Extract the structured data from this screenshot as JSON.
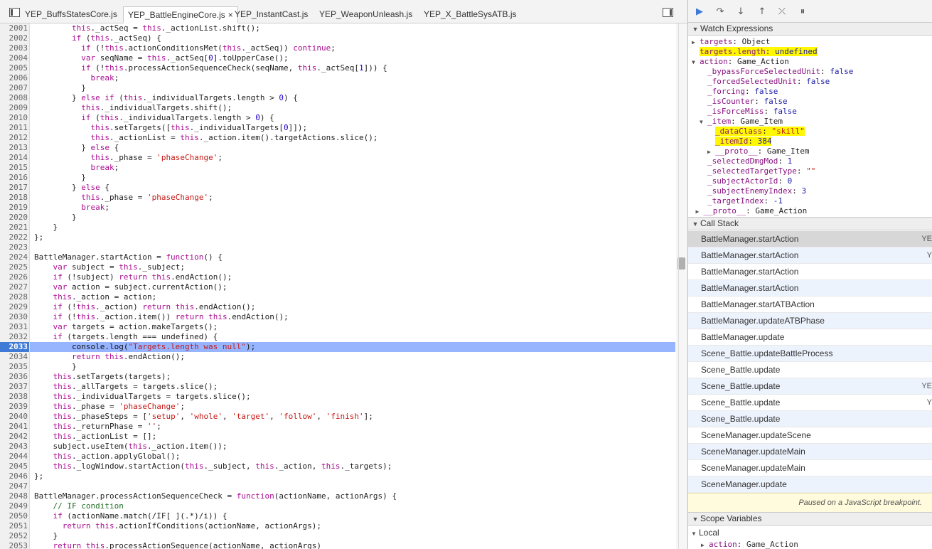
{
  "tabs": {
    "nav_left_icon": "panel-toggle-icon",
    "nav_right_icon": "panel-toggle-icon",
    "items": [
      {
        "label": "YEP_BuffsStatesCore.js"
      },
      {
        "label": "YEP_BattleEngineCore.js",
        "active": true,
        "close": "×"
      },
      {
        "label": "YEP_InstantCast.js"
      },
      {
        "label": "YEP_WeaponUnleash.js"
      },
      {
        "label": "YEP_X_BattleSysATB.js"
      }
    ]
  },
  "debug_toolbar": {
    "resume_icon": "▶",
    "step_over_icon": "↷",
    "step_into_icon": "↓",
    "step_out_icon": "↑",
    "deactivate_icon": "⤫",
    "pause_exceptions_icon": "⏸"
  },
  "code": [
    {
      "n": "2001",
      "t": "        this._actSeq = this._actionList.shift();"
    },
    {
      "n": "2002",
      "t": "        if (this._actSeq) {"
    },
    {
      "n": "2003",
      "t": "          if (!this.actionConditionsMet(this._actSeq)) continue;"
    },
    {
      "n": "2004",
      "t": "          var seqName = this._actSeq[0].toUpperCase();"
    },
    {
      "n": "2005",
      "t": "          if (!this.processActionSequenceCheck(seqName, this._actSeq[1])) {"
    },
    {
      "n": "2006",
      "t": "            break;"
    },
    {
      "n": "2007",
      "t": "          }"
    },
    {
      "n": "2008",
      "t": "        } else if (this._individualTargets.length > 0) {"
    },
    {
      "n": "2009",
      "t": "          this._individualTargets.shift();"
    },
    {
      "n": "2010",
      "t": "          if (this._individualTargets.length > 0) {"
    },
    {
      "n": "2011",
      "t": "            this.setTargets([this._individualTargets[0]]);"
    },
    {
      "n": "2012",
      "t": "            this._actionList = this._action.item().targetActions.slice();"
    },
    {
      "n": "2013",
      "t": "          } else {"
    },
    {
      "n": "2014",
      "t": "            this._phase = 'phaseChange';"
    },
    {
      "n": "2015",
      "t": "            break;"
    },
    {
      "n": "2016",
      "t": "          }"
    },
    {
      "n": "2017",
      "t": "        } else {"
    },
    {
      "n": "2018",
      "t": "          this._phase = 'phaseChange';"
    },
    {
      "n": "2019",
      "t": "          break;"
    },
    {
      "n": "2020",
      "t": "        }"
    },
    {
      "n": "2021",
      "t": "    }"
    },
    {
      "n": "2022",
      "t": "};"
    },
    {
      "n": "2023",
      "t": ""
    },
    {
      "n": "2024",
      "t": "BattleManager.startAction = function() {"
    },
    {
      "n": "2025",
      "t": "    var subject = this._subject;"
    },
    {
      "n": "2026",
      "t": "    if (!subject) return this.endAction();"
    },
    {
      "n": "2027",
      "t": "    var action = subject.currentAction();"
    },
    {
      "n": "2028",
      "t": "    this._action = action;"
    },
    {
      "n": "2029",
      "t": "    if (!this._action) return this.endAction();"
    },
    {
      "n": "2030",
      "t": "    if (!this._action.item()) return this.endAction();"
    },
    {
      "n": "2031",
      "t": "    var targets = action.makeTargets();"
    },
    {
      "n": "2032",
      "t": "    if (targets.length === undefined) {"
    },
    {
      "n": "2033",
      "t": "        console.log(\"Targets.length was null\");",
      "exec": true
    },
    {
      "n": "2034",
      "t": "        return this.endAction();"
    },
    {
      "n": "2035",
      "t": "        }"
    },
    {
      "n": "2036",
      "t": "    this.setTargets(targets);"
    },
    {
      "n": "2037",
      "t": "    this._allTargets = targets.slice();"
    },
    {
      "n": "2038",
      "t": "    this._individualTargets = targets.slice();"
    },
    {
      "n": "2039",
      "t": "    this._phase = 'phaseChange';"
    },
    {
      "n": "2040",
      "t": "    this._phaseSteps = ['setup', 'whole', 'target', 'follow', 'finish'];"
    },
    {
      "n": "2041",
      "t": "    this._returnPhase = '';"
    },
    {
      "n": "2042",
      "t": "    this._actionList = [];"
    },
    {
      "n": "2043",
      "t": "    subject.useItem(this._action.item());"
    },
    {
      "n": "2044",
      "t": "    this._action.applyGlobal();"
    },
    {
      "n": "2045",
      "t": "    this._logWindow.startAction(this._subject, this._action, this._targets);"
    },
    {
      "n": "2046",
      "t": "};"
    },
    {
      "n": "2047",
      "t": ""
    },
    {
      "n": "2048",
      "t": "BattleManager.processActionSequenceCheck = function(actionName, actionArgs) {"
    },
    {
      "n": "2049",
      "t": "    // IF condition"
    },
    {
      "n": "2050",
      "t": "    if (actionName.match(/IF[ ](.*)/i)) {"
    },
    {
      "n": "2051",
      "t": "      return this.actionIfConditions(actionName, actionArgs);"
    },
    {
      "n": "2052",
      "t": "    }"
    },
    {
      "n": "2053",
      "t": "    return this.processActionSequence(actionName, actionArgs)"
    }
  ],
  "watch": {
    "title": "Watch Expressions",
    "rows": [
      {
        "indent": 0,
        "tri": "▶",
        "key": "targets",
        "sep": ": ",
        "val": "Object",
        "type": "obj"
      },
      {
        "indent": 0,
        "tri": "",
        "key": "targets.length",
        "sep": ": ",
        "val": "undefined",
        "type": "prim",
        "hl": true
      },
      {
        "indent": 0,
        "tri": "▼",
        "key": "action",
        "sep": ": ",
        "val": "Game_Action",
        "type": "obj"
      },
      {
        "indent": 1,
        "tri": "",
        "key": "_bypassForceSelectedUnit",
        "sep": ": ",
        "val": "false",
        "type": "prim"
      },
      {
        "indent": 1,
        "tri": "",
        "key": "_forcedSelectedUnit",
        "sep": ": ",
        "val": "false",
        "type": "prim"
      },
      {
        "indent": 1,
        "tri": "",
        "key": "_forcing",
        "sep": ": ",
        "val": "false",
        "type": "prim"
      },
      {
        "indent": 1,
        "tri": "",
        "key": "_isCounter",
        "sep": ": ",
        "val": "false",
        "type": "prim"
      },
      {
        "indent": 1,
        "tri": "",
        "key": "_isForceMiss",
        "sep": ": ",
        "val": "false",
        "type": "prim"
      },
      {
        "indent": 1,
        "tri": "▼",
        "key": "_item",
        "sep": ": ",
        "val": "Game_Item",
        "type": "obj"
      },
      {
        "indent": 2,
        "tri": "",
        "key": "_dataClass",
        "sep": ": ",
        "val": "\"skill\"",
        "type": "str",
        "hl": true
      },
      {
        "indent": 2,
        "tri": "",
        "key": "_itemId",
        "sep": ": ",
        "val": "384",
        "type": "prim",
        "hl": true
      },
      {
        "indent": 2,
        "tri": "▶",
        "key": "__proto__",
        "sep": ": ",
        "val": "Game_Item",
        "type": "obj"
      },
      {
        "indent": 1,
        "tri": "",
        "key": "_selectedDmgMod",
        "sep": ": ",
        "val": "1",
        "type": "prim"
      },
      {
        "indent": 1,
        "tri": "",
        "key": "_selectedTargetType",
        "sep": ": ",
        "val": "\"\"",
        "type": "str"
      },
      {
        "indent": 1,
        "tri": "",
        "key": "_subjectActorId",
        "sep": ": ",
        "val": "0",
        "type": "prim"
      },
      {
        "indent": 1,
        "tri": "",
        "key": "_subjectEnemyIndex",
        "sep": ": ",
        "val": "3",
        "type": "prim"
      },
      {
        "indent": 1,
        "tri": "",
        "key": "_targetIndex",
        "sep": ": ",
        "val": "-1",
        "type": "prim"
      },
      {
        "indent": 0.5,
        "tri": "▶",
        "key": "__proto__",
        "sep": ": ",
        "val": "Game_Action",
        "type": "obj"
      }
    ]
  },
  "callstack": {
    "title": "Call Stack",
    "frames": [
      {
        "name": "BattleManager.startAction",
        "loc": "YE",
        "state": "selected"
      },
      {
        "name": "BattleManager.startAction",
        "loc": "Y",
        "state": "alt"
      },
      {
        "name": "BattleManager.startAction",
        "loc": "",
        "state": ""
      },
      {
        "name": "BattleManager.startAction",
        "loc": "",
        "state": "alt"
      },
      {
        "name": "BattleManager.startATBAction",
        "loc": "",
        "state": ""
      },
      {
        "name": "BattleManager.updateATBPhase",
        "loc": "",
        "state": "alt"
      },
      {
        "name": "BattleManager.update",
        "loc": "",
        "state": ""
      },
      {
        "name": "Scene_Battle.updateBattleProcess",
        "loc": "",
        "state": "alt"
      },
      {
        "name": "Scene_Battle.update",
        "loc": "",
        "state": ""
      },
      {
        "name": "Scene_Battle.update",
        "loc": "YE",
        "state": "alt"
      },
      {
        "name": "Scene_Battle.update",
        "loc": "Y",
        "state": ""
      },
      {
        "name": "Scene_Battle.update",
        "loc": "",
        "state": "alt"
      },
      {
        "name": "SceneManager.updateScene",
        "loc": "",
        "state": ""
      },
      {
        "name": "SceneManager.updateMain",
        "loc": "",
        "state": "alt"
      },
      {
        "name": "SceneManager.updateMain",
        "loc": "",
        "state": ""
      },
      {
        "name": "SceneManager.update",
        "loc": "",
        "state": "alt"
      }
    ],
    "paused_message": "Paused on a JavaScript breakpoint."
  },
  "scope": {
    "title": "Scope Variables",
    "local_label": "Local",
    "first_key": "action",
    "first_val": "Game_Action"
  }
}
